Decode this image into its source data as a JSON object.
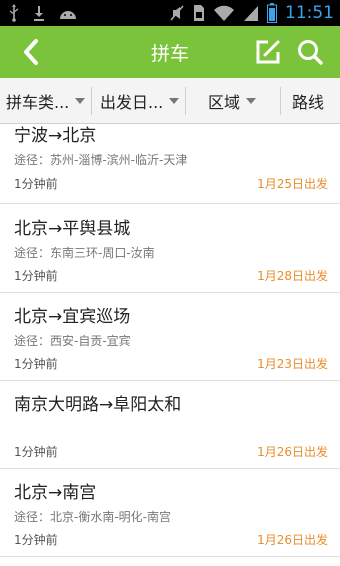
{
  "status_bar": {
    "time": "11:51",
    "icons": [
      "usb-icon",
      "download-icon",
      "android-icon",
      "mute-icon",
      "sim-icon",
      "wifi-icon",
      "signal-icon",
      "battery-icon"
    ]
  },
  "header": {
    "title": "拼车",
    "background_color": "#7cc33c",
    "back_icon": "back-arrow-icon",
    "edit_icon": "edit-icon",
    "search_icon": "search-icon"
  },
  "filters": [
    {
      "label": "拼车类..."
    },
    {
      "label": "出发日..."
    },
    {
      "label": "区域"
    },
    {
      "label": "路线"
    }
  ],
  "items": [
    {
      "route": "宁波→北京",
      "via": "途径：苏州-淄博-滨州-临沂-天津",
      "ago": "1分钟前",
      "date": "1月25日出发"
    },
    {
      "route": "北京→平舆县城",
      "via": "途径：东南三环-周口-汝南",
      "ago": "1分钟前",
      "date": "1月28日出发"
    },
    {
      "route": "北京→宜宾巡场",
      "via": "途径：西安-自贡-宜宾",
      "ago": "1分钟前",
      "date": "1月23日出发"
    },
    {
      "route": "南京大明路→阜阳太和",
      "via": "",
      "ago": "1分钟前",
      "date": "1月26日出发"
    },
    {
      "route": "北京→南宫",
      "via": "途径：北京-衡水南-明化-南宫",
      "ago": "1分钟前",
      "date": "1月26日出发"
    }
  ]
}
